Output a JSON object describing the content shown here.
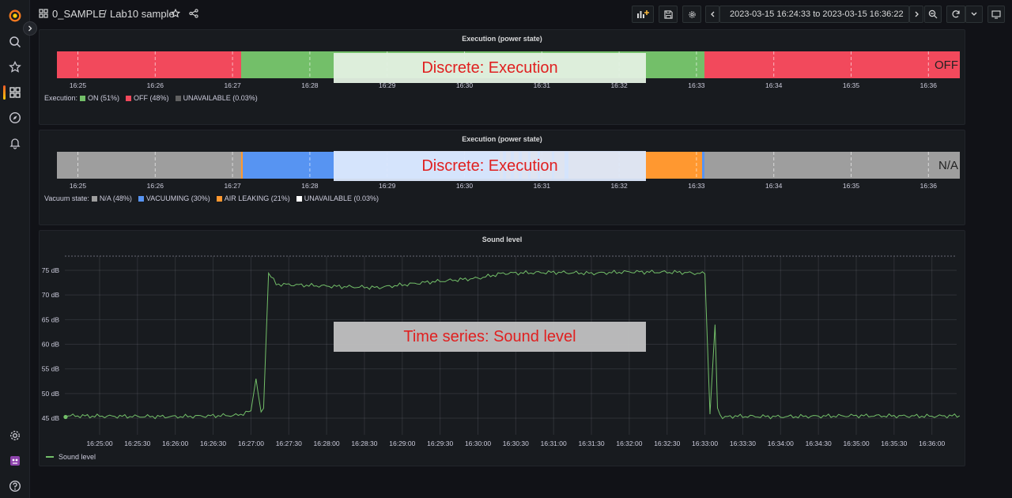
{
  "nav": {
    "items": [
      "logo",
      "search",
      "starred",
      "dashboards",
      "explore",
      "alerting",
      "configuration",
      "plugin",
      "help"
    ]
  },
  "topbar": {
    "folder": "0_SAMPLE",
    "separator": "/",
    "dashboard": "Lab10 sample",
    "time_range": "2023-03-15 16:24:33 to 2023-03-15 16:36:22"
  },
  "panel1": {
    "title": "Execution (power state)",
    "bar_end_label": "OFF",
    "ticks": [
      "16:25",
      "16:26",
      "16:27",
      "16:28",
      "16:29",
      "16:30",
      "16:31",
      "16:32",
      "16:33",
      "16:34",
      "16:35",
      "16:36"
    ],
    "legend_name": "Execution:",
    "legend": [
      {
        "label": "ON (51%)",
        "color": "#73bf69"
      },
      {
        "label": "OFF (48%)",
        "color": "#f2495c"
      },
      {
        "label": "UNAVAILABLE (0.03%)",
        "color": "#616161"
      }
    ],
    "overlay": "Discrete: Execution"
  },
  "panel2": {
    "title": "Execution (power state)",
    "bar_end_label": "N/A",
    "ticks": [
      "16:25",
      "16:26",
      "16:27",
      "16:28",
      "16:29",
      "16:30",
      "16:31",
      "16:32",
      "16:33",
      "16:34",
      "16:35",
      "16:36"
    ],
    "legend_name": "Vacuum state:",
    "legend": [
      {
        "label": "N/A (48%)",
        "color": "#9e9e9e"
      },
      {
        "label": "VACUUMING (30%)",
        "color": "#5794f2"
      },
      {
        "label": "AIR LEAKING (21%)",
        "color": "#ff9830"
      },
      {
        "label": "UNAVAILABLE (0.03%)",
        "color": "#ffffff"
      }
    ],
    "overlay": "Discrete: Execution"
  },
  "panel3": {
    "title": "Sound level",
    "legend": "Sound level",
    "overlay": "Time series: Sound level"
  },
  "chart_data": {
    "type": "line",
    "title": "Sound level",
    "x_start": "16:24:33",
    "x_end": "16:36:22",
    "x_ticks": [
      "16:25:00",
      "16:25:30",
      "16:26:00",
      "16:26:30",
      "16:27:00",
      "16:27:30",
      "16:28:00",
      "16:28:30",
      "16:29:00",
      "16:29:30",
      "16:30:00",
      "16:30:30",
      "16:31:00",
      "16:31:30",
      "16:32:00",
      "16:32:30",
      "16:33:00",
      "16:33:30",
      "16:34:00",
      "16:34:30",
      "16:35:00",
      "16:35:30",
      "16:36:00"
    ],
    "y_ticks": [
      "45 dB",
      "50 dB",
      "55 dB",
      "60 dB",
      "65 dB",
      "70 dB",
      "75 dB"
    ],
    "ylim": [
      43.5,
      77.5
    ],
    "grid": true,
    "legend_position": "bottom-left",
    "series": [
      {
        "name": "Sound level",
        "color": "#73bf69",
        "x": [
          "16:24:33",
          "16:25:00",
          "16:26:00",
          "16:26:50",
          "16:27:00",
          "16:27:04",
          "16:27:08",
          "16:27:10",
          "16:27:14",
          "16:27:20",
          "16:28:00",
          "16:28:40",
          "16:29:20",
          "16:30:00",
          "16:30:20",
          "16:31:00",
          "16:31:30",
          "16:32:00",
          "16:32:40",
          "16:33:00",
          "16:33:04",
          "16:33:08",
          "16:33:10",
          "16:33:14",
          "16:33:20",
          "16:34:00",
          "16:35:00",
          "16:36:00",
          "16:36:22"
        ],
        "y": [
          45.5,
          45.4,
          45.3,
          45.6,
          46.5,
          53.0,
          46.0,
          47.0,
          74.5,
          72.2,
          71.8,
          71.5,
          72.6,
          73.4,
          74.4,
          74.6,
          74.4,
          74.7,
          74.6,
          74.3,
          45.8,
          64.0,
          47.0,
          45.0,
          45.4,
          45.3,
          45.5,
          45.4,
          45.5
        ]
      }
    ]
  }
}
